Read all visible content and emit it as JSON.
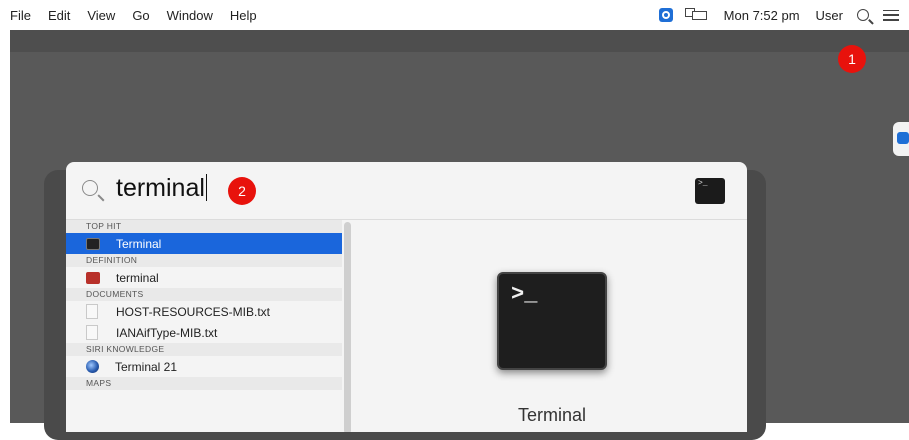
{
  "menubar": {
    "items": [
      "File",
      "Edit",
      "View",
      "Go",
      "Window",
      "Help"
    ],
    "clock": "Mon 7:52 pm",
    "user": "User",
    "icons": [
      "teamviewer-icon",
      "display-mirroring-icon",
      "spotlight-search-icon",
      "notification-center-icon"
    ]
  },
  "annotations": {
    "badge1": "1",
    "badge2": "2",
    "badge_color": "#e8120c"
  },
  "spotlight": {
    "query": "terminal",
    "sections": [
      {
        "header": "TOP HIT",
        "items": [
          {
            "label": "Terminal",
            "icon": "terminal-icon",
            "selected": true
          }
        ]
      },
      {
        "header": "DEFINITION",
        "items": [
          {
            "label": "terminal",
            "icon": "dictionary-icon"
          }
        ]
      },
      {
        "header": "DOCUMENTS",
        "items": [
          {
            "label": "HOST-RESOURCES-MIB.txt",
            "icon": "text-document-icon"
          },
          {
            "label": "IANAifType-MIB.txt",
            "icon": "text-document-icon"
          }
        ]
      },
      {
        "header": "SIRI KNOWLEDGE",
        "items": [
          {
            "label": "Terminal 21",
            "icon": "siri-knowledge-icon"
          }
        ]
      },
      {
        "header": "MAPS",
        "items": []
      }
    ],
    "preview": {
      "prompt": ">_",
      "name": "Terminal"
    },
    "selection_color": "#1a66dc"
  }
}
